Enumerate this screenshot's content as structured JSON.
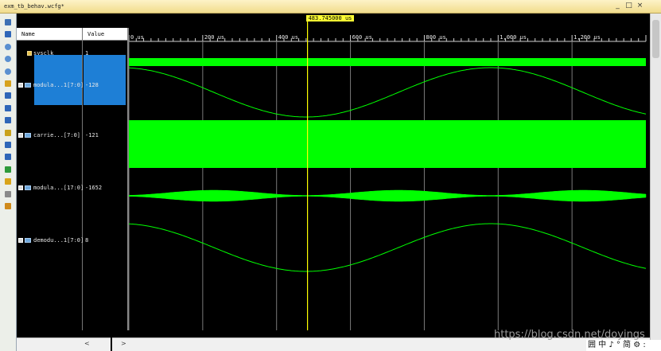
{
  "window": {
    "title": "exm_tb_behav.wcfg*",
    "controls": {
      "minimize": "_",
      "restore": "□",
      "close": "×"
    }
  },
  "toolbar": {
    "icons": [
      "zoom-fit-icon",
      "save-icon",
      "zoom-in-icon",
      "zoom-out-icon",
      "zoom-full-icon",
      "go-to-cursor-icon",
      "first-edge-icon",
      "previous-edge-icon",
      "next-edge-icon",
      "add-marker-icon",
      "previous-marker-icon",
      "next-marker-icon",
      "swap-icon",
      "snap-icon",
      "ruler-icon",
      "settings-icon"
    ]
  },
  "columns": {
    "name": "Name",
    "value": "Value"
  },
  "signals": [
    {
      "name": "sysclk",
      "value": "1",
      "kind": "bit"
    },
    {
      "name": "modula...1[7:0]",
      "value": "-128",
      "kind": "bus",
      "selected": true
    },
    {
      "name": "carrie...[7:0]",
      "value": "-121",
      "kind": "bus"
    },
    {
      "name": "modula...[17:0]",
      "value": "-1652",
      "kind": "bus"
    },
    {
      "name": "demodu...1[7:0]",
      "value": "8",
      "kind": "bus"
    }
  ],
  "timeline": {
    "ticks": [
      "0 us",
      "200 us",
      "400 us",
      "600 us",
      "800 us",
      "1,000 us",
      "1,200 us"
    ],
    "cursor_label": "483.745000 us",
    "cursor_time_us": 483.745,
    "range_us": [
      0,
      1400
    ]
  },
  "colors": {
    "wave": "#00ff00",
    "cursor": "#ffff00",
    "selection": "#1e7fd6",
    "background": "#000000"
  },
  "scroll_arrows": {
    "left": "<",
    "right": ">"
  },
  "watermark": "https://blog.csdn.net/doyings",
  "ime": "囲 中 ♪ ° 简 ⚙ :"
}
